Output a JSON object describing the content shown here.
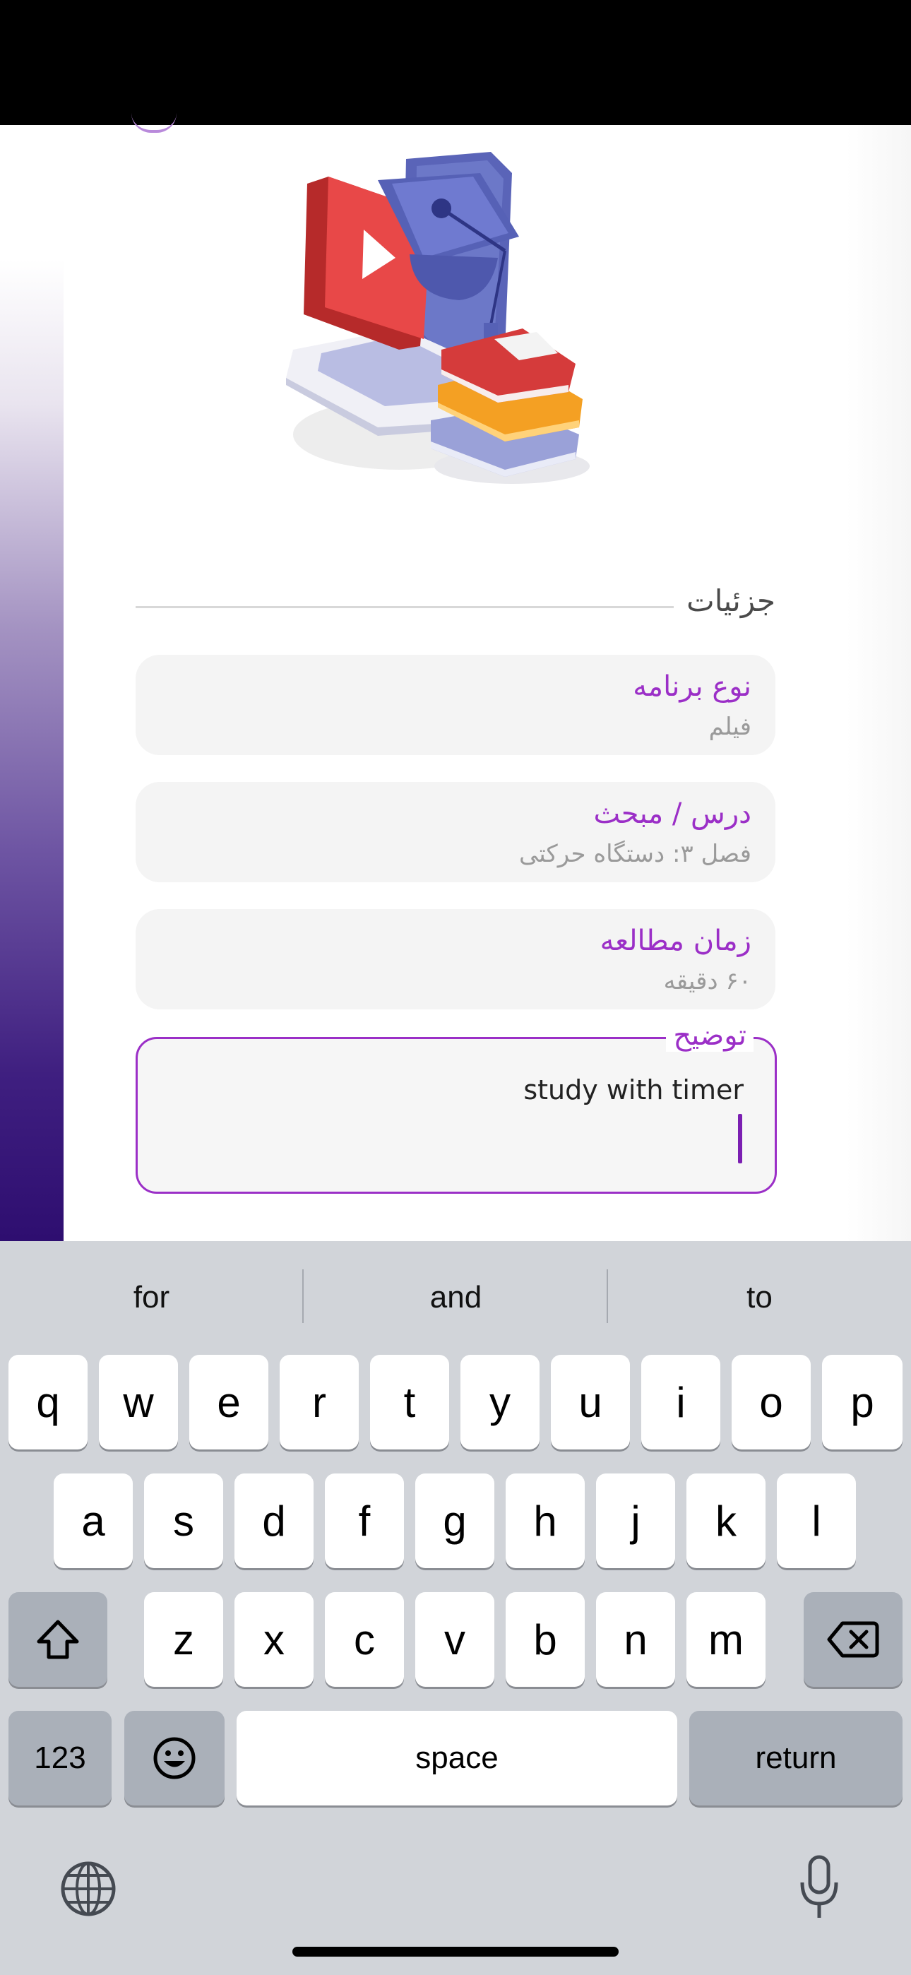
{
  "details": {
    "section_title": "جزئیات",
    "fields": [
      {
        "label": "نوع برنامه",
        "value": "فیلم"
      },
      {
        "label": "درس / مبحث",
        "value": "فصل ۳: دستگاه حرکتی"
      },
      {
        "label": "زمان مطالعه",
        "value": "۶۰ دقیقه"
      }
    ],
    "description": {
      "label": "توضیح",
      "value": "study with timer"
    }
  },
  "keyboard": {
    "suggestions": [
      "for",
      "and",
      "to"
    ],
    "row1": [
      "q",
      "w",
      "e",
      "r",
      "t",
      "y",
      "u",
      "i",
      "o",
      "p"
    ],
    "row2": [
      "a",
      "s",
      "d",
      "f",
      "g",
      "h",
      "j",
      "k",
      "l"
    ],
    "row3": [
      "z",
      "x",
      "c",
      "v",
      "b",
      "n",
      "m"
    ],
    "numbers_key": "123",
    "space_key": "space",
    "return_key": "return"
  },
  "colors": {
    "accent": "#9b2fc7",
    "keyboard_bg": "#d1d4d9",
    "key_dark": "#aab0b9"
  }
}
